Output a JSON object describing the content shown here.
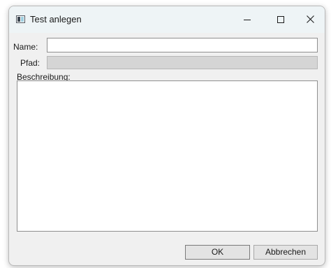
{
  "window": {
    "title": "Test anlegen",
    "icon": "app-window-icon"
  },
  "titlebar_buttons": {
    "minimize": "minimize-icon",
    "maximize": "maximize-icon",
    "close": "close-icon"
  },
  "form": {
    "name_label": "Name:",
    "name_value": "",
    "path_label": "Pfad:",
    "path_value": "",
    "description_label": "Beschreibung:",
    "description_value": ""
  },
  "buttons": {
    "ok_label": "OK",
    "cancel_label": "Abbrechen"
  },
  "colors": {
    "titlebar": "#eef4f6",
    "window_background": "#f0f0f0",
    "disabled_field": "#d5d5d5"
  }
}
